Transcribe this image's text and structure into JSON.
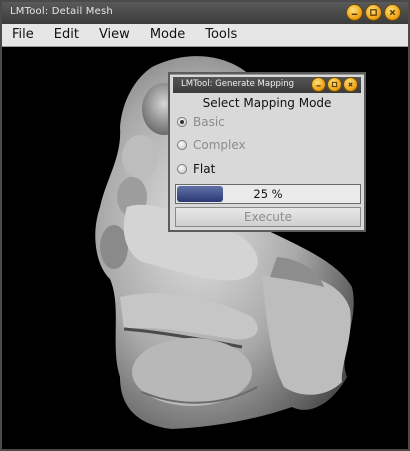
{
  "window": {
    "title": "LMTool: Detail Mesh"
  },
  "menubar": {
    "items": [
      "File",
      "Edit",
      "View",
      "Mode",
      "Tools"
    ]
  },
  "dialog": {
    "title": "LMTool: Generate Mapping",
    "heading": "Select Mapping Mode",
    "options": [
      {
        "label": "Basic",
        "selected": true,
        "enabled": false
      },
      {
        "label": "Complex",
        "selected": false,
        "enabled": false
      },
      {
        "label": "Flat",
        "selected": false,
        "enabled": true
      }
    ],
    "progress": {
      "value_percent": 25,
      "text": "25 %"
    },
    "execute_label": "Execute"
  },
  "icons": {
    "window_controls": [
      "minimize-icon",
      "maximize-icon",
      "close-icon"
    ],
    "dialog_controls": [
      "minimize-icon",
      "maximize-icon",
      "close-icon"
    ]
  },
  "colors": {
    "control_orb": "#f1a51b",
    "progress_fill": "#2c3a73",
    "viewport_bg": "#000000"
  }
}
